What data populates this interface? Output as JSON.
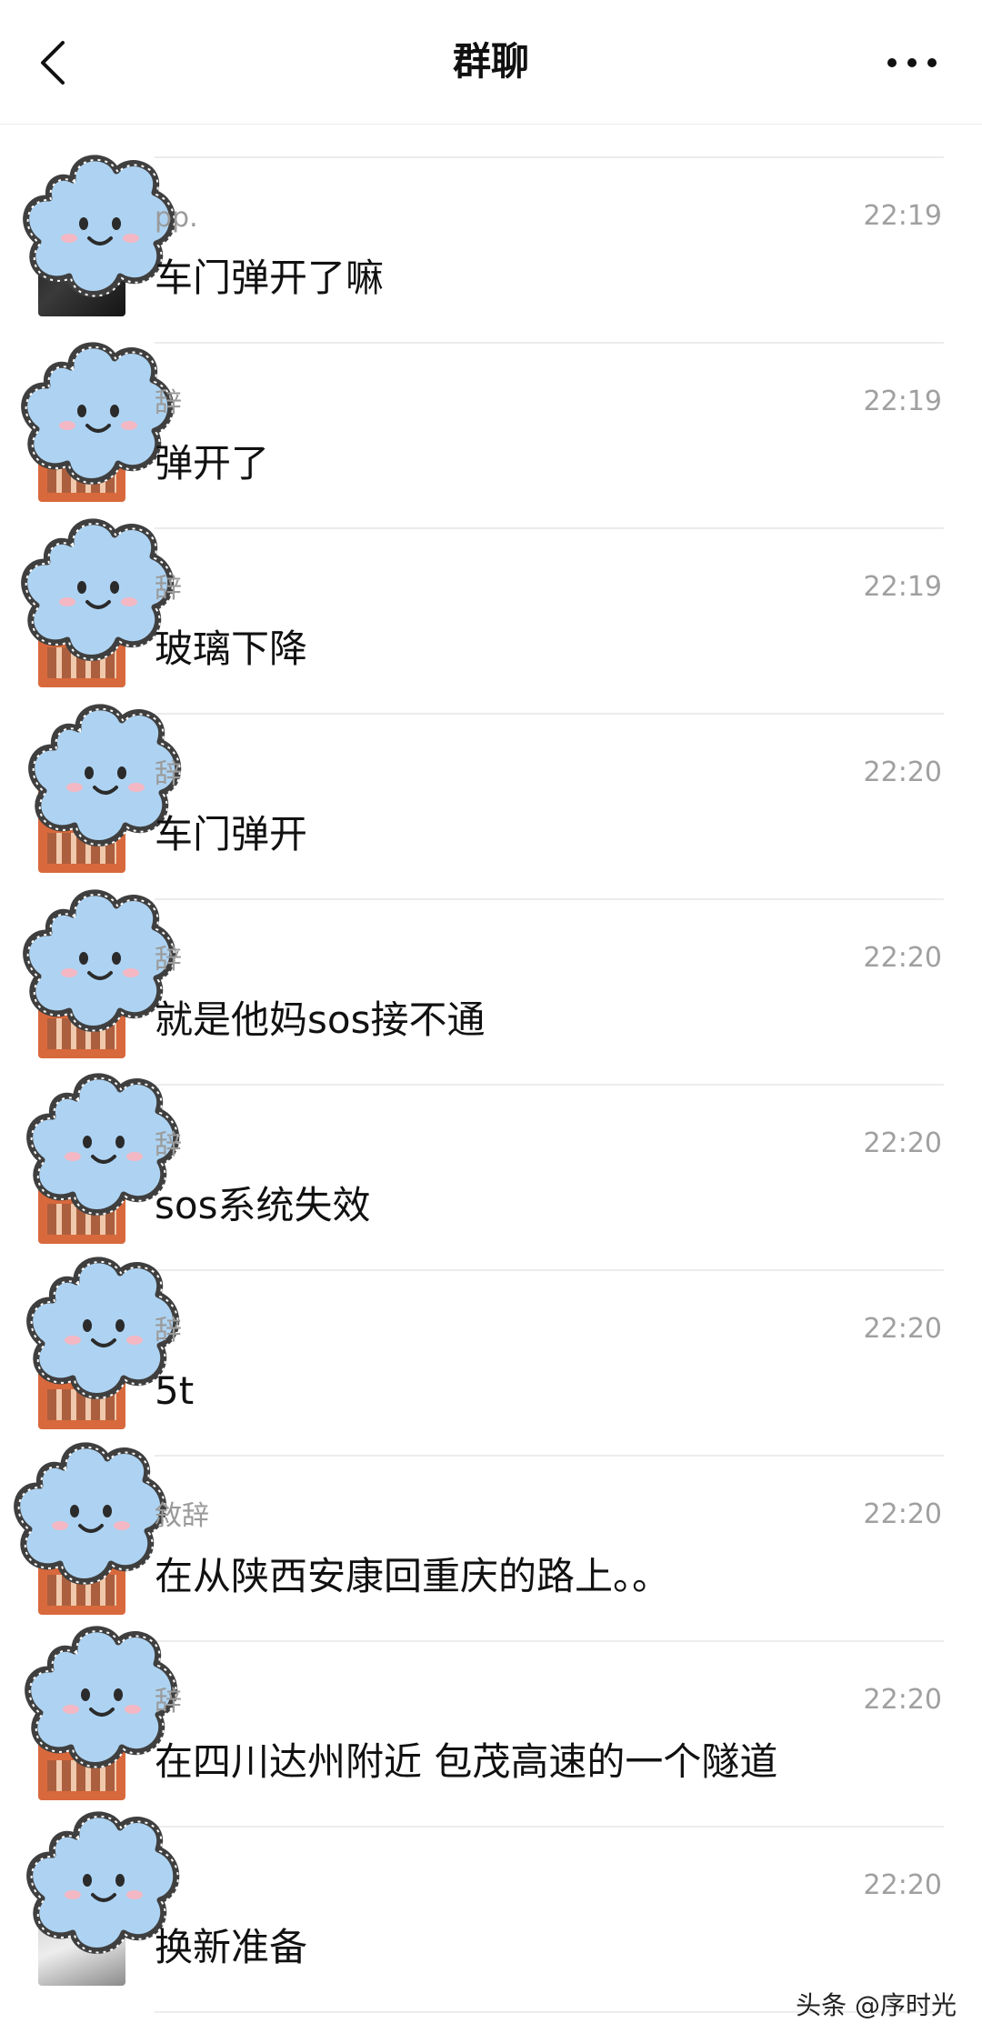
{
  "header": {
    "title": "群聊"
  },
  "messages": [
    {
      "sender": "pp.",
      "time": "22:19",
      "text": "车门弹开了嘛",
      "avatar": "dark"
    },
    {
      "sender": "辞",
      "time": "22:19",
      "text": "弹开了",
      "avatar": "warm"
    },
    {
      "sender": "辞",
      "time": "22:19",
      "text": "玻璃下降",
      "avatar": "warm"
    },
    {
      "sender": "辞",
      "time": "22:20",
      "text": "车门弹开",
      "avatar": "warm"
    },
    {
      "sender": "辞",
      "time": "22:20",
      "text": "就是他妈sos接不通",
      "avatar": "warm"
    },
    {
      "sender": "辞",
      "time": "22:20",
      "text": "sos系统失效",
      "avatar": "warm"
    },
    {
      "sender": "辞",
      "time": "22:20",
      "text": "5t",
      "avatar": "warm"
    },
    {
      "sender": "敘辞",
      "time": "22:20",
      "text": "在从陕西安康回重庆的路上。。",
      "avatar": "warm"
    },
    {
      "sender": "辞",
      "time": "22:20",
      "text": "在四川达州附近 包茂高速的一个隧道",
      "avatar": "warm"
    },
    {
      "sender": "",
      "time": "22:20",
      "text": "换新准备",
      "avatar": "gray"
    }
  ],
  "watermark": "头条 @序时光"
}
